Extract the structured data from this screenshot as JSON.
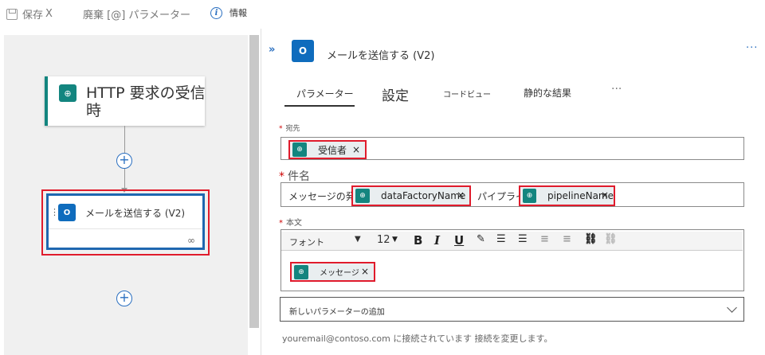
{
  "toolbar": {
    "save_label": "保存",
    "save_close": "X",
    "discard_label": "廃棄 [@] パラメーター",
    "info_label": "情報"
  },
  "designer": {
    "trigger_title": "HTTP 要求の受信時",
    "action_title": "メールを送信する (V2)"
  },
  "panel": {
    "title": "メールを送信する (V2)",
    "tabs": [
      {
        "label": "パラメーター"
      },
      {
        "label": "設定"
      },
      {
        "label": "コードビュー"
      },
      {
        "label": "静的な結果"
      },
      {
        "label": "···"
      }
    ],
    "to": {
      "label": "宛先",
      "token": "受信者"
    },
    "subject": {
      "label": "件名",
      "text1": "メッセージの発生",
      "token1": "dataFactoryName",
      "text2": "パイプライン",
      "token2": "pipelineName"
    },
    "body": {
      "label": "本文",
      "font_label": "フォント",
      "font_size": "12",
      "token": "メッセージ"
    },
    "add_param": "新しいパラメーターの追加",
    "footer": "youremail@contoso.com に接続されています 接続を変更します。"
  },
  "colors": {
    "accent": "#2a6fc0",
    "trigger": "#13857f",
    "outlook": "#0f6cbd",
    "highlight": "#e01b2c"
  }
}
